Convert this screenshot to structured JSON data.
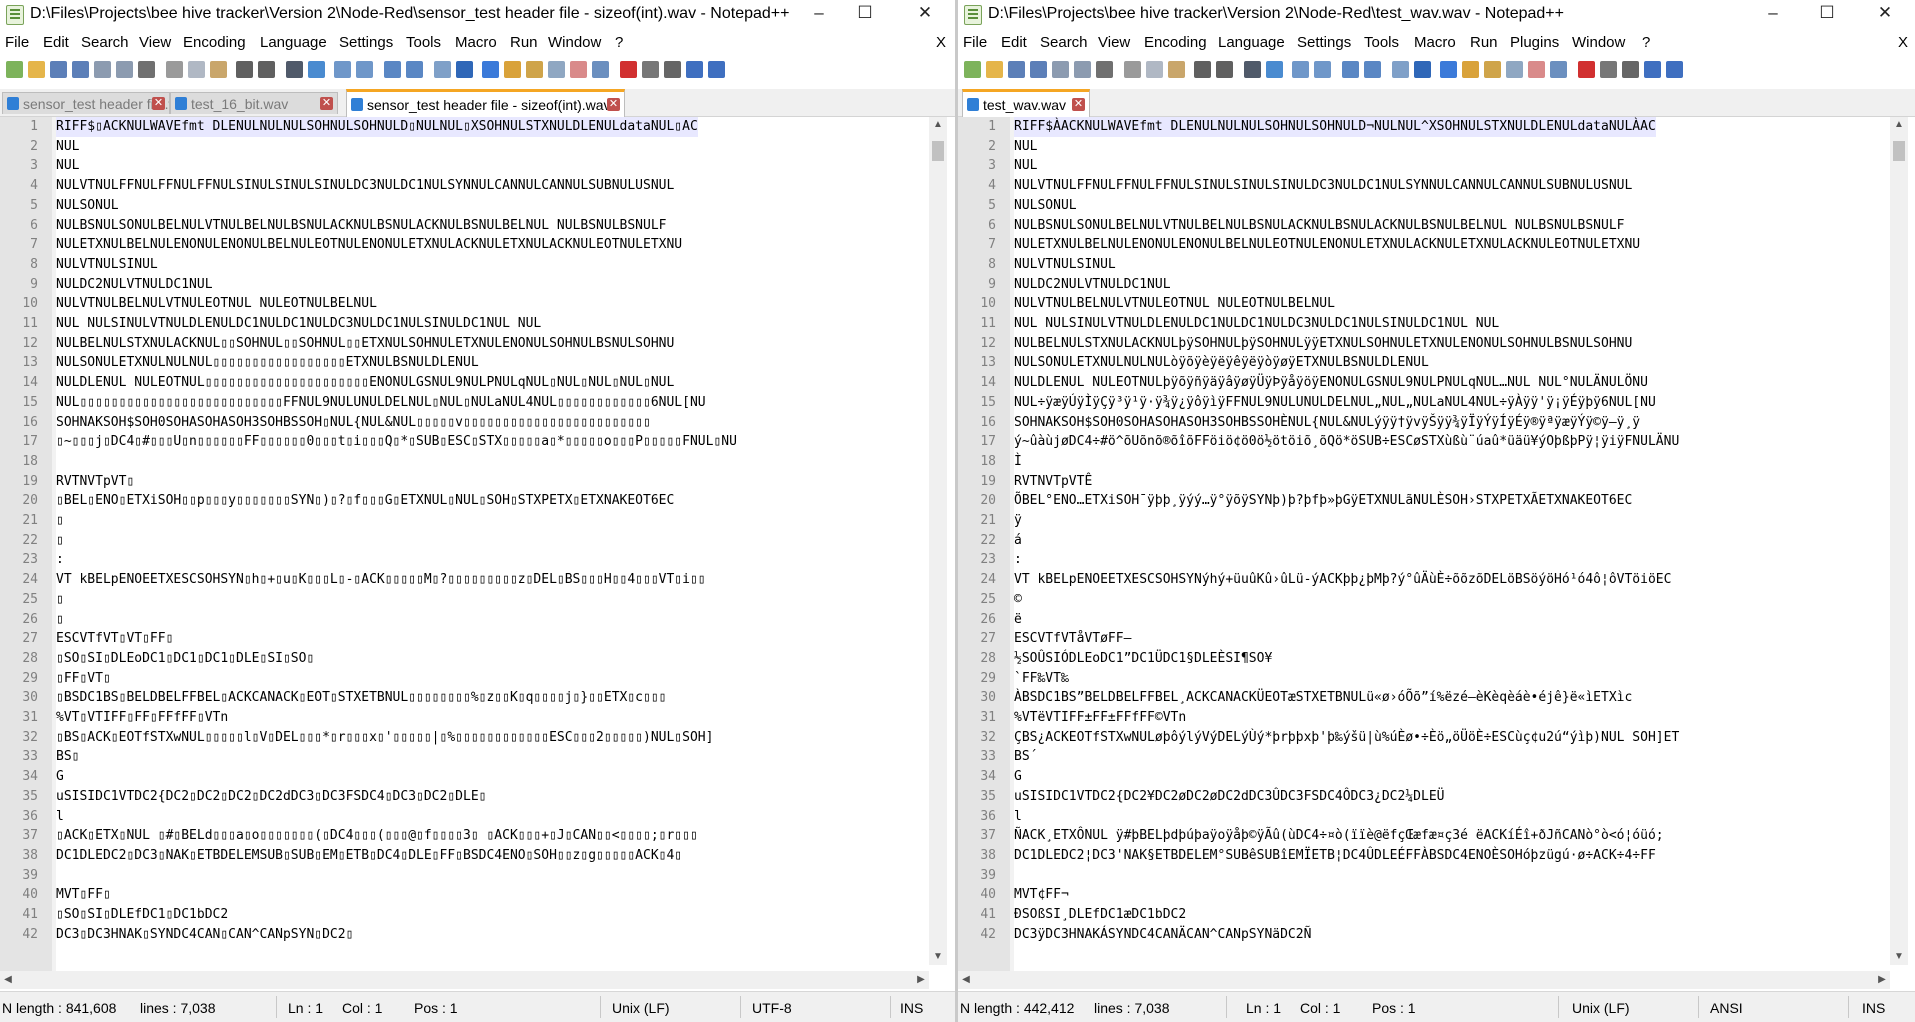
{
  "windows": [
    {
      "title": "D:\\Files\\Projects\\bee hive tracker\\Version 2\\Node-Red\\sensor_test header file - sizeof(int).wav - Notepad++",
      "controls": {
        "minimize": "–",
        "maximize": "☐",
        "close": "✕"
      },
      "menu": [
        "File",
        "Edit",
        "Search",
        "View",
        "Encoding",
        "Language",
        "Settings",
        "Tools",
        "Macro",
        "Run",
        "Window",
        "?"
      ],
      "menu_close": "X",
      "tabs": [
        {
          "label": "sensor_test header file.wav",
          "active": false
        },
        {
          "label": "test_16_bit.wav",
          "active": false
        },
        {
          "label": "sensor_test header file - sizeof(int).wav",
          "active": true
        }
      ],
      "lines": [
        {
          "n": "1",
          "t": "RIFF$▯ACKNULWAVEfmt DLENULNULNULSOHNULSOHNULD▯NULNUL▯XSOHNULSTXNULDLENULdataNUL▯AC"
        },
        {
          "n": "2",
          "t": "NUL"
        },
        {
          "n": "3",
          "t": "NUL"
        },
        {
          "n": "4",
          "t": "NULVTNULFFNULFFNULFFNULSINULSINULSINULDC3NULDC1NULSYNNULCANNULCANNULSUBNULUSNUL"
        },
        {
          "n": "5",
          "t": "NULSONUL"
        },
        {
          "n": "6",
          "t": "NULBSNULSONULBELNULVTNULBELNULBSNULACKNULBSNULACKNULBSNULBELNUL  NULBSNULBSNULF"
        },
        {
          "n": "7",
          "t": "NULETXNULBELNULENONULENONULBELNULEOTNULENONULETXNULACKNULETXNULACKNULEOTNULETXNU"
        },
        {
          "n": "8",
          "t": "NULVTNULSINUL"
        },
        {
          "n": "9",
          "t": "NULDC2NULVTNULDC1NUL"
        },
        {
          "n": "10",
          "t": "NULVTNULBELNULVTNULEOTNUL NULEOTNULBELNUL"
        },
        {
          "n": "11",
          "t": "NUL NULSINULVTNULDLENULDC1NULDC1NULDC3NULDC1NULSINULDC1NUL NUL"
        },
        {
          "n": "12",
          "t": "NULBELNULSTXNULACKNUL▯▯SOHNUL▯▯SOHNUL▯▯ETXNULSOHNULETXNULENONULSOHNULBSNULSOHNU"
        },
        {
          "n": "13",
          "t": "NULSONULETXNULNULNUL▯▯▯▯▯▯▯▯▯▯▯▯▯▯▯▯▯ETXNULBSNULDLENUL"
        },
        {
          "n": "14",
          "t": "NULDLENUL  NULEOTNUL▯▯▯▯▯▯▯▯▯▯▯▯▯▯▯▯▯▯▯▯▯ENONULGSNUL9NULPNULqNUL▯NUL▯NUL▯NUL▯NUL"
        },
        {
          "n": "15",
          "t": "NUL▯▯▯▯▯▯▯▯▯▯▯▯▯▯▯▯▯▯▯▯▯▯▯▯▯▯FFNUL9NULUNULDELNUL▯NUL▯NULaNUL4NUL▯▯▯▯▯▯▯▯▯▯▯▯6NUL[NU"
        },
        {
          "n": "16",
          "t": "SOHNAKSOH$SOH0SOHASOHASOH3SOHBSSOH▯NUL{NUL&NUL▯▯▯▯▯v▯▯▯▯▯▯▯▯▯▯▯▯▯▯▯▯▯▯▯▯▯▯▯▯"
        },
        {
          "n": "17",
          "t": "▯~▯▯▯j▯DC4▯#▯▯▯U▯n▯▯▯▯▯▯FF▯▯▯▯▯▯0▯▯▯t▯i▯▯▯Q▯*▯SUB▯ESC▯STX▯▯▯▯▯a▯*▯▯▯▯▯o▯▯▯P▯▯▯▯▯FNUL▯NU"
        },
        {
          "n": "18",
          "t": ""
        },
        {
          "n": "19",
          "t": "RVTNVTpVT▯"
        },
        {
          "n": "20",
          "t": "  ▯BEL▯ENO▯ETXiSOH▯▯p▯▯▯y▯▯▯▯▯▯▯SYN▯)▯?▯f▯▯▯G▯ETXNUL▯NUL▯SOH▯STXPETX▯ETXNAKEOT6EC"
        },
        {
          "n": "21",
          "t": "▯"
        },
        {
          "n": "22",
          "t": "▯"
        },
        {
          "n": "23",
          "t": ":"
        },
        {
          "n": "24",
          "t": "VT  kBELpENOEETXESCSOHSYN▯h▯+▯u▯K▯▯▯L▯-▯ACK▯▯▯▯▯M▯?▯▯▯▯▯▯▯▯▯z▯DEL▯BS▯▯▯H▯▯4▯▯▯VT▯i▯▯"
        },
        {
          "n": "25",
          "t": "▯"
        },
        {
          "n": "26",
          "t": "▯"
        },
        {
          "n": "27",
          "t": "ESCVTfVT▯VT▯FF▯"
        },
        {
          "n": "28",
          "t": "▯SO▯SI▯DLEoDC1▯DC1▯DC1▯DLE▯SI▯SO▯"
        },
        {
          "n": "29",
          "t": "▯FF▯VT▯"
        },
        {
          "n": "30",
          "t": "  ▯BSDC1BS▯BELDBELFFBEL▯ACKCANACK▯EOT▯STXETBNUL▯▯▯▯▯▯▯▯%▯z▯▯K▯q▯▯▯▯j▯}▯▯ETX▯c▯▯▯"
        },
        {
          "n": "31",
          "t": "%VT▯VTIFF▯FF▯FFfFF▯VTn"
        },
        {
          "n": "32",
          "t": "▯BS▯ACK▯EOTfSTXwNUL▯▯▯▯▯l▯V▯DEL▯▯▯*▯r▯▯▯x▯'▯▯▯▯▯|▯%▯▯▯▯▯▯▯▯▯▯▯▯ESC▯▯▯2▯▯▯▯▯)NUL▯SOH]"
        },
        {
          "n": "33",
          "t": "BS▯"
        },
        {
          "n": "34",
          "t": "G"
        },
        {
          "n": "35",
          "t": "uSISIDC1VTDC2{DC2▯DC2▯DC2▯DC2dDC3▯DC3FSDC4▯DC3▯DC2▯DLE▯"
        },
        {
          "n": "36",
          "t": "l"
        },
        {
          "n": "37",
          "t": "▯ACK▯ETX▯NUL  ▯#▯BELd▯▯▯a▯o▯▯▯▯▯▯▯(▯DC4▯▯▯(▯▯▯@▯f▯▯▯▯3▯ ▯ACK▯▯▯+▯J▯CAN▯▯<▯▯▯▯;▯r▯▯▯"
        },
        {
          "n": "38",
          "t": "DC1DLEDC2▯DC3▯NAK▯ETBDELEMSUB▯SUB▯EM▯ETB▯DC4▯DLE▯FF▯BSDC4ENO▯SOH▯▯z▯g▯▯▯▯▯ACK▯4▯"
        },
        {
          "n": "39",
          "t": ""
        },
        {
          "n": "40",
          "t": "MVT▯FF▯"
        },
        {
          "n": "41",
          "t": "▯SO▯SI▯DLEfDC1▯DC1bDC2"
        },
        {
          "n": "42",
          "t": "DC3▯DC3HNAK▯SYNDC4CAN▯CAN^CANpSYN▯DC2▯"
        }
      ],
      "status": {
        "length": "N length : 841,608",
        "lines": "lines : 7,038",
        "ln": "Ln : 1",
        "col": "Col : 1",
        "pos": "Pos : 1",
        "eol": "Unix (LF)",
        "encoding": "UTF-8",
        "mode": "INS"
      }
    },
    {
      "title": "D:\\Files\\Projects\\bee hive tracker\\Version 2\\Node-Red\\test_wav.wav - Notepad++",
      "controls": {
        "minimize": "–",
        "maximize": "☐",
        "close": "✕"
      },
      "menu": [
        "File",
        "Edit",
        "Search",
        "View",
        "Encoding",
        "Language",
        "Settings",
        "Tools",
        "Macro",
        "Run",
        "Plugins",
        "Window",
        "?"
      ],
      "menu_close": "X",
      "tabs": [
        {
          "label": "test_wav.wav",
          "active": true
        }
      ],
      "lines": [
        {
          "n": "1",
          "t": "RIFF$ÀACKNULWAVEfmt DLENULNULNULSOHNULSOHNULD¬NULNUL^XSOHNULSTXNULDLENULdataNULÀAC"
        },
        {
          "n": "2",
          "t": "NUL"
        },
        {
          "n": "3",
          "t": "NUL"
        },
        {
          "n": "4",
          "t": "NULVTNULFFNULFFNULFFNULSINULSINULSINULDC3NULDC1NULSYNNULCANNULCANNULSUBNULUSNUL"
        },
        {
          "n": "5",
          "t": "NULSONUL"
        },
        {
          "n": "6",
          "t": "NULBSNULSONULBELNULVTNULBELNULBSNULACKNULBSNULACKNULBSNULBELNUL  NULBSNULBSNULF"
        },
        {
          "n": "7",
          "t": "NULETXNULBELNULENONULENONULBELNULEOTNULENONULETXNULACKNULETXNULACKNULEOTNULETXNU"
        },
        {
          "n": "8",
          "t": "NULVTNULSINUL"
        },
        {
          "n": "9",
          "t": "NULDC2NULVTNULDC1NUL"
        },
        {
          "n": "10",
          "t": "NULVTNULBELNULVTNULEOTNUL NULEOTNULBELNUL"
        },
        {
          "n": "11",
          "t": "NUL NULSINULVTNULDLENULDC1NULDC1NULDC3NULDC1NULSINULDC1NUL NUL"
        },
        {
          "n": "12",
          "t": "NULBELNULSTXNULACKNULþÿSOHNULþÿSOHNULÿÿETXNULSOHNULETXNULENONULSOHNULBSNULSOHNU"
        },
        {
          "n": "13",
          "t": "NULSONULETXNULNULNULòÿõÿèÿëÿêÿëÿòÿøÿETXNULBSNULDLENUL"
        },
        {
          "n": "14",
          "t": "NULDLENUL  NULEOTNULþÿõÿñÿäÿâÿøÿÜÿÞÿåÿöÿENONULGSNUL9NULPNULqNUL…NUL NUL°NULÄNULÖNU"
        },
        {
          "n": "15",
          "t": "NUL÷ÿæÿÚÿÌÿÇÿ³ÿ¹ÿ·ÿ¾ÿ¿ÿôÿìÿFFNUL9NULUNULDELNUL„NUL„NULaNUL4NUL÷ÿÀÿÿ'ÿ¡ÿÉÿþÿ6NUL[NU"
        },
        {
          "n": "16",
          "t": "SOHNAKSOH$SOH0SOHASOHASOH3SOHBSSOHÈNUL{NUL&NULýÿÿ†ÿvÿŠÿÿ¾ÿÏÿÝÿÍÿÉÿ®ÿªÿæÿÝÿ©ÿ–ÿ¸ÿ"
        },
        {
          "n": "17",
          "t": "ý~ûàùjøDC4÷#ö^õUõnõ®õîõFFöiö¢ö0ö½ötöiõ¸õQö*öSUB÷ESCøSTXùßù¨úaû*üäü¥ýOþßþPÿ¦ÿiÿFNULÄNU"
        },
        {
          "n": "18",
          "t": "Ì"
        },
        {
          "n": "19",
          "t": "RVTNVTpVTÊ"
        },
        {
          "n": "20",
          "t": "  ÕBEL°ENO…ETXiSOH¯ÿþþ¸ÿýý…ÿ°ÿõÿSYNþ)þ?þfþ»þGÿETXNULãNULÈSOH›STXPETXÃETXNAKEOT6EC"
        },
        {
          "n": "21",
          "t": "ÿ"
        },
        {
          "n": "22",
          "t": "á"
        },
        {
          "n": "23",
          "t": ":"
        },
        {
          "n": "24",
          "t": "VT  kBELpENOEETXESCSOHSYNýhý+üuûKû›ûLü-ýACKþþ¿þMþ?ý°ûÄùÈ÷õõzõDELöBSöýöHó¹ó4ô¦ôVTöiöEC"
        },
        {
          "n": "25",
          "t": "©"
        },
        {
          "n": "26",
          "t": "ë"
        },
        {
          "n": "27",
          "t": "ESCVTfVTåVTøFF–"
        },
        {
          "n": "28",
          "t": "½SOÛSIÓDLEoDC1”DC1ÜDC1§DLEÈSI¶SO¥"
        },
        {
          "n": "29",
          "t": "`FF‰VT‰"
        },
        {
          "n": "30",
          "t": "  ÀBSDC1BS”BELDBELFFBEL¸ACKCANACKÜEOTæSTXETBNULü«ø›óÕõ”í%ëzé—èKèqèáè•éjê}ë«ìETXìc"
        },
        {
          "n": "31",
          "t": "%VTëVTIFF±FF±FFfFF©VTn"
        },
        {
          "n": "32",
          "t": "ÇBS¿ACKEOTfSTXwNULøþôýlýVýDELýÙý*þrþþxþ'þ‰ýšü|ù%úÈø•÷Èö„öÜöÈ÷ESCùç¢u2ú“ýìþ)NUL SOH]ET"
        },
        {
          "n": "33",
          "t": "BS´"
        },
        {
          "n": "34",
          "t": "G"
        },
        {
          "n": "35",
          "t": "uSISIDC1VTDC2{DC2¥DC2øDC2øDC2dDC3ÛDC3FSDC4ÔDC3¿DC2¼DLEÜ"
        },
        {
          "n": "36",
          "t": "l"
        },
        {
          "n": "37",
          "t": "ÑACK¸ETXÔNUL  ÿ#þBELþdþúþaÿoÿåþ©ÿÃû(ùDC4÷¤ò(ïïè@ëfçŒæfæ¤ç3é ëACKíÉî+ðJñCANò°ò<ó¦óüó;"
        },
        {
          "n": "38",
          "t": "DC1DLEDC2¦DC3'NAK§ETBDELEM°SUBêSUBîEMÏETB¦DC4ÛDLEÉFFÀBSDC4ENOÈSOHóþzügú·ø÷ACK÷4÷FF"
        },
        {
          "n": "39",
          "t": ""
        },
        {
          "n": "40",
          "t": "MVT¢FF¬"
        },
        {
          "n": "41",
          "t": "ÐSOßSI¸DLEfDC1æDC1bDC2"
        },
        {
          "n": "42",
          "t": "DC3ÿDC3HNAKÁSYNDC4CANÄCAN^CANpSYNäDC2Ñ"
        }
      ],
      "status": {
        "length": "N length : 442,412",
        "lines": "lines : 7,038",
        "ln": "Ln : 1",
        "col": "Col : 1",
        "pos": "Pos : 1",
        "eol": "Unix (LF)",
        "encoding": "ANSI",
        "mode": "INS"
      }
    }
  ],
  "colors": {
    "tab_accent": "#f5a623",
    "gutter": "#e4e4e4",
    "close_tab": "#c0504d",
    "tab_icon": "#2f7fd6"
  }
}
